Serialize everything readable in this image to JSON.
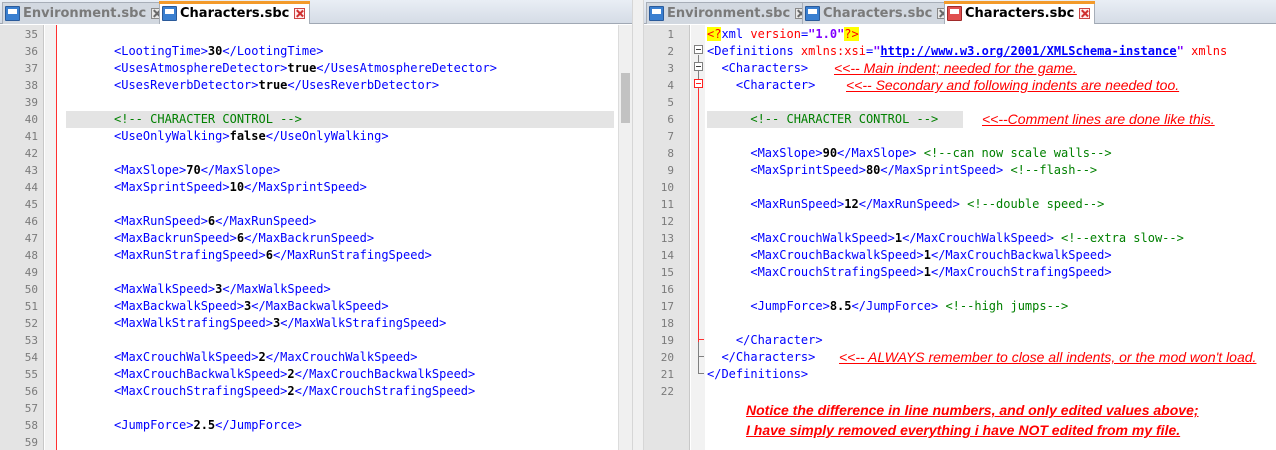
{
  "left_pane": {
    "tabs": [
      {
        "label": "Environment.sbc",
        "active": false
      },
      {
        "label": "Characters.sbc",
        "active": true
      }
    ],
    "lines": [
      {
        "n": "35",
        "code": []
      },
      {
        "n": "36",
        "code": [
          {
            "t": "tag",
            "s": "<LootingTime>"
          },
          {
            "t": "val",
            "s": "30"
          },
          {
            "t": "tag",
            "s": "</LootingTime>"
          }
        ]
      },
      {
        "n": "37",
        "code": [
          {
            "t": "tag",
            "s": "<UsesAtmosphereDetector>"
          },
          {
            "t": "val",
            "s": "true"
          },
          {
            "t": "tag",
            "s": "</UsesAtmosphereDetector>"
          }
        ]
      },
      {
        "n": "38",
        "code": [
          {
            "t": "tag",
            "s": "<UsesReverbDetector>"
          },
          {
            "t": "val",
            "s": "true"
          },
          {
            "t": "tag",
            "s": "</UsesReverbDetector>"
          }
        ]
      },
      {
        "n": "39",
        "code": []
      },
      {
        "n": "40",
        "code": [
          {
            "t": "comment",
            "s": "<!-- CHARACTER CONTROL -->"
          }
        ],
        "highlight": true
      },
      {
        "n": "41",
        "code": [
          {
            "t": "tag",
            "s": "<UseOnlyWalking>"
          },
          {
            "t": "val",
            "s": "false"
          },
          {
            "t": "tag",
            "s": "</UseOnlyWalking>"
          }
        ]
      },
      {
        "n": "42",
        "code": []
      },
      {
        "n": "43",
        "code": [
          {
            "t": "tag",
            "s": "<MaxSlope>"
          },
          {
            "t": "val",
            "s": "70"
          },
          {
            "t": "tag",
            "s": "</MaxSlope>"
          }
        ]
      },
      {
        "n": "44",
        "code": [
          {
            "t": "tag",
            "s": "<MaxSprintSpeed>"
          },
          {
            "t": "val",
            "s": "10"
          },
          {
            "t": "tag",
            "s": "</MaxSprintSpeed>"
          }
        ]
      },
      {
        "n": "45",
        "code": []
      },
      {
        "n": "46",
        "code": [
          {
            "t": "tag",
            "s": "<MaxRunSpeed>"
          },
          {
            "t": "val",
            "s": "6"
          },
          {
            "t": "tag",
            "s": "</MaxRunSpeed>"
          }
        ]
      },
      {
        "n": "47",
        "code": [
          {
            "t": "tag",
            "s": "<MaxBackrunSpeed>"
          },
          {
            "t": "val",
            "s": "6"
          },
          {
            "t": "tag",
            "s": "</MaxBackrunSpeed>"
          }
        ]
      },
      {
        "n": "48",
        "code": [
          {
            "t": "tag",
            "s": "<MaxRunStrafingSpeed>"
          },
          {
            "t": "val",
            "s": "6"
          },
          {
            "t": "tag",
            "s": "</MaxRunStrafingSpeed>"
          }
        ]
      },
      {
        "n": "49",
        "code": []
      },
      {
        "n": "50",
        "code": [
          {
            "t": "tag",
            "s": "<MaxWalkSpeed>"
          },
          {
            "t": "val",
            "s": "3"
          },
          {
            "t": "tag",
            "s": "</MaxWalkSpeed>"
          }
        ]
      },
      {
        "n": "51",
        "code": [
          {
            "t": "tag",
            "s": "<MaxBackwalkSpeed>"
          },
          {
            "t": "val",
            "s": "3"
          },
          {
            "t": "tag",
            "s": "</MaxBackwalkSpeed>"
          }
        ]
      },
      {
        "n": "52",
        "code": [
          {
            "t": "tag",
            "s": "<MaxWalkStrafingSpeed>"
          },
          {
            "t": "val",
            "s": "3"
          },
          {
            "t": "tag",
            "s": "</MaxWalkStrafingSpeed>"
          }
        ]
      },
      {
        "n": "53",
        "code": []
      },
      {
        "n": "54",
        "code": [
          {
            "t": "tag",
            "s": "<MaxCrouchWalkSpeed>"
          },
          {
            "t": "val",
            "s": "2"
          },
          {
            "t": "tag",
            "s": "</MaxCrouchWalkSpeed>"
          }
        ]
      },
      {
        "n": "55",
        "code": [
          {
            "t": "tag",
            "s": "<MaxCrouchBackwalkSpeed>"
          },
          {
            "t": "val",
            "s": "2"
          },
          {
            "t": "tag",
            "s": "</MaxCrouchBackwalkSpeed>"
          }
        ]
      },
      {
        "n": "56",
        "code": [
          {
            "t": "tag",
            "s": "<MaxCrouchStrafingSpeed>"
          },
          {
            "t": "val",
            "s": "2"
          },
          {
            "t": "tag",
            "s": "</MaxCrouchStrafingSpeed>"
          }
        ]
      },
      {
        "n": "57",
        "code": []
      },
      {
        "n": "58",
        "code": [
          {
            "t": "tag",
            "s": "<JumpForce>"
          },
          {
            "t": "val",
            "s": "2.5"
          },
          {
            "t": "tag",
            "s": "</JumpForce>"
          }
        ]
      },
      {
        "n": "59",
        "code": []
      }
    ]
  },
  "right_pane": {
    "tabs": [
      {
        "label": "Environment.sbc",
        "active": false
      },
      {
        "label": "Characters.sbc",
        "active": false
      },
      {
        "label": "Characters.sbc",
        "active": true
      }
    ],
    "lines": [
      {
        "n": "1",
        "code": [
          {
            "t": "pi",
            "s": "<?"
          },
          {
            "t": "tag",
            "s": "xml "
          },
          {
            "t": "attr",
            "s": "version"
          },
          {
            "t": "tag",
            "s": "="
          },
          {
            "t": "str",
            "s": "\"1.0\""
          },
          {
            "t": "pi",
            "s": "?>"
          }
        ]
      },
      {
        "n": "2",
        "code": [
          {
            "t": "tag",
            "s": "<Definitions "
          },
          {
            "t": "attr",
            "s": "xmlns:xsi"
          },
          {
            "t": "tag",
            "s": "="
          },
          {
            "t": "str",
            "s": "\""
          },
          {
            "t": "url",
            "s": "http://www.w3.org/2001/XMLSchema-instance"
          },
          {
            "t": "str",
            "s": "\""
          },
          {
            "t": "attr",
            "s": " xmlns"
          }
        ]
      },
      {
        "n": "3",
        "code": [
          {
            "t": "tag",
            "s": "  <Characters>"
          }
        ]
      },
      {
        "n": "4",
        "code": [
          {
            "t": "tag",
            "s": "    <Character>"
          }
        ]
      },
      {
        "n": "5",
        "code": []
      },
      {
        "n": "6",
        "code": [
          {
            "t": "comment",
            "s": "      <!-- CHARACTER CONTROL -->"
          }
        ],
        "highlight": true
      },
      {
        "n": "7",
        "code": []
      },
      {
        "n": "8",
        "code": [
          {
            "t": "tag",
            "s": "      <MaxSlope>"
          },
          {
            "t": "val",
            "s": "90"
          },
          {
            "t": "tag",
            "s": "</MaxSlope>"
          },
          {
            "t": "comment",
            "s": " <!--can now scale walls-->"
          }
        ]
      },
      {
        "n": "9",
        "code": [
          {
            "t": "tag",
            "s": "      <MaxSprintSpeed>"
          },
          {
            "t": "val",
            "s": "80"
          },
          {
            "t": "tag",
            "s": "</MaxSprintSpeed>"
          },
          {
            "t": "comment",
            "s": " <!--flash-->"
          }
        ]
      },
      {
        "n": "10",
        "code": []
      },
      {
        "n": "11",
        "code": [
          {
            "t": "tag",
            "s": "      <MaxRunSpeed>"
          },
          {
            "t": "val",
            "s": "12"
          },
          {
            "t": "tag",
            "s": "</MaxRunSpeed>"
          },
          {
            "t": "comment",
            "s": " <!--double speed-->"
          }
        ]
      },
      {
        "n": "12",
        "code": []
      },
      {
        "n": "13",
        "code": [
          {
            "t": "tag",
            "s": "      <MaxCrouchWalkSpeed>"
          },
          {
            "t": "val",
            "s": "1"
          },
          {
            "t": "tag",
            "s": "</MaxCrouchWalkSpeed>"
          },
          {
            "t": "comment",
            "s": " <!--extra slow-->"
          }
        ]
      },
      {
        "n": "14",
        "code": [
          {
            "t": "tag",
            "s": "      <MaxCrouchBackwalkSpeed>"
          },
          {
            "t": "val",
            "s": "1"
          },
          {
            "t": "tag",
            "s": "</MaxCrouchBackwalkSpeed>"
          }
        ]
      },
      {
        "n": "15",
        "code": [
          {
            "t": "tag",
            "s": "      <MaxCrouchStrafingSpeed>"
          },
          {
            "t": "val",
            "s": "1"
          },
          {
            "t": "tag",
            "s": "</MaxCrouchStrafingSpeed>"
          }
        ]
      },
      {
        "n": "16",
        "code": []
      },
      {
        "n": "17",
        "code": [
          {
            "t": "tag",
            "s": "      <JumpForce>"
          },
          {
            "t": "val",
            "s": "8.5"
          },
          {
            "t": "tag",
            "s": "</JumpForce>"
          },
          {
            "t": "comment",
            "s": " <!--high jumps-->"
          }
        ]
      },
      {
        "n": "18",
        "code": []
      },
      {
        "n": "19",
        "code": [
          {
            "t": "tag",
            "s": "    </Character>"
          }
        ]
      },
      {
        "n": "20",
        "code": [
          {
            "t": "tag",
            "s": "  </Characters>"
          }
        ]
      },
      {
        "n": "21",
        "code": [
          {
            "t": "tag",
            "s": "</Definitions>"
          }
        ]
      },
      {
        "n": "22",
        "code": []
      }
    ],
    "annotations": {
      "main_indent": "<<-- Main indent; needed for the game.",
      "secondary_indent": "<<-- Secondary and following indents are needed too.",
      "comment_lines": "<<--Comment lines are done like this.",
      "close_indents": "<<-- ALWAYS remember to close all indents, or the mod won't load.",
      "notice_line1": "Notice the difference in line numbers, and only edited values above;",
      "notice_line2": "I have simply removed everything i have NOT edited from my file."
    }
  },
  "colors": {
    "tag": "#0000ff",
    "comment": "#008000",
    "annotation": "#ff0000",
    "active_tab_accent": "#f39a2a"
  }
}
